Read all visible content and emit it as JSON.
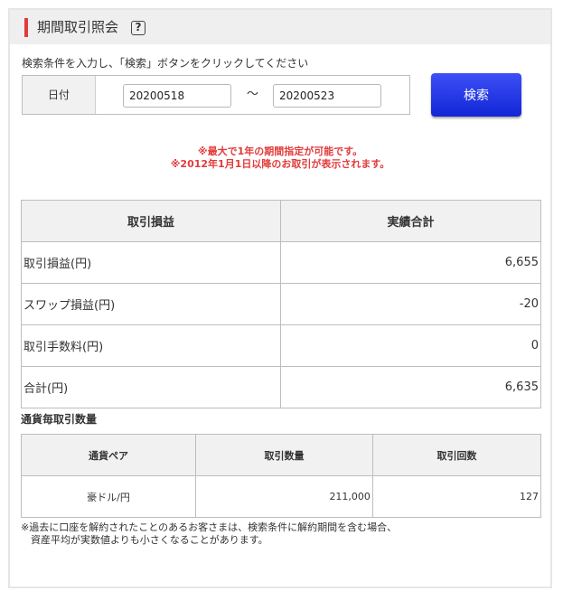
{
  "header": {
    "title": "期間取引照会",
    "help_label": "?"
  },
  "search": {
    "instruction": "検索条件を入力し、「検索」ボタンをクリックしてください",
    "date_label": "日付",
    "from_value": "20200518",
    "to_value": "20200523",
    "separator": "～",
    "button_label": "検索"
  },
  "notes": [
    "※最大で1年の期間指定が可能です。",
    "※2012年1月1日以降のお取引が表示されます。"
  ],
  "pnl_table": {
    "headers": [
      "取引損益",
      "実績合計"
    ],
    "rows": [
      {
        "label": "取引損益(円)",
        "value": "6,655"
      },
      {
        "label": "スワップ損益(円)",
        "value": "-20"
      },
      {
        "label": "取引手数料(円)",
        "value": "0"
      },
      {
        "label": "合計(円)",
        "value": "6,635"
      }
    ]
  },
  "currency_section": {
    "title": "通貨毎取引数量",
    "headers": [
      "通貨ペア",
      "取引数量",
      "取引回数"
    ],
    "rows": [
      {
        "pair": "豪ドル/円",
        "quantity": "211,000",
        "count": "127"
      }
    ]
  },
  "footnote": "※過去に口座を解約されたことのあるお客さまは、検索条件に解約期間を含む場合、\n　資産平均が実数値よりも小さくなることがあります。",
  "colors": {
    "accent": "#e03b3b",
    "button": "#1a2ee0",
    "note_text": "#e23b3b"
  }
}
